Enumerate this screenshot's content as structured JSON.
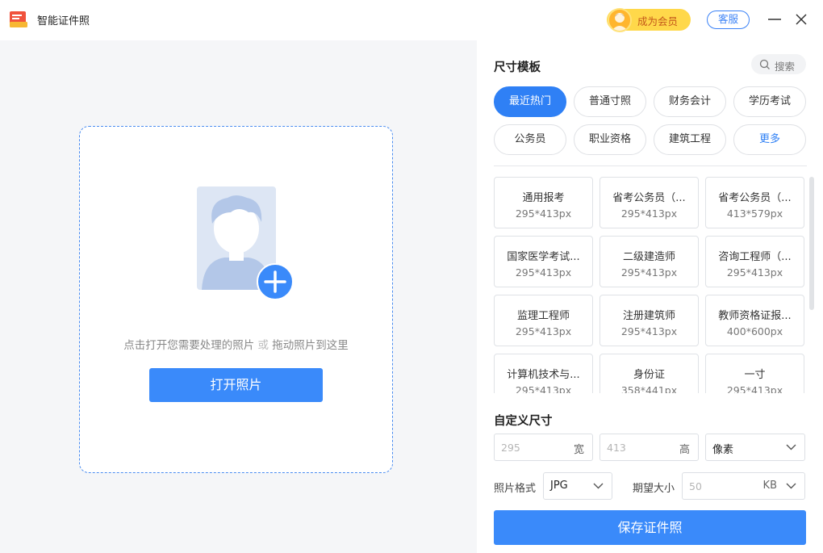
{
  "app": {
    "title": "智能证件照"
  },
  "header": {
    "vip_label": "成为会员",
    "service_label": "客服"
  },
  "upload": {
    "hint_part1": "点击打开您需要处理的照片",
    "hint_or": "或",
    "hint_part2": "拖动照片到这里",
    "open_button": "打开照片"
  },
  "templates": {
    "title": "尺寸模板",
    "search_label": "搜索",
    "categories": [
      "最近热门",
      "普通寸照",
      "财务会计",
      "学历考试",
      "公务员",
      "职业资格",
      "建筑工程",
      "更多"
    ],
    "items": [
      {
        "name": "通用报考",
        "size": "295*413px"
      },
      {
        "name": "省考公务员（...",
        "size": "295*413px"
      },
      {
        "name": "省考公务员（...",
        "size": "413*579px"
      },
      {
        "name": "国家医学考试...",
        "size": "295*413px"
      },
      {
        "name": "二级建造师",
        "size": "295*413px"
      },
      {
        "name": "咨询工程师（...",
        "size": "295*413px"
      },
      {
        "name": "监理工程师",
        "size": "295*413px"
      },
      {
        "name": "注册建筑师",
        "size": "295*413px"
      },
      {
        "name": "教师资格证报...",
        "size": "400*600px"
      },
      {
        "name": "计算机技术与...",
        "size": "295*413px"
      },
      {
        "name": "身份证",
        "size": "358*441px"
      },
      {
        "name": "一寸",
        "size": "295*413px"
      }
    ]
  },
  "custom": {
    "title": "自定义尺寸",
    "width_placeholder": "295",
    "width_unit": "宽",
    "height_placeholder": "413",
    "height_unit": "高",
    "unit_select": "像素",
    "format_label": "照片格式",
    "format_value": "JPG",
    "size_label": "期望大小",
    "size_placeholder": "50",
    "size_unit": "KB",
    "save_button": "保存证件照"
  },
  "colors": {
    "accent": "#3a8afa",
    "vip_bg": "#ffd84a",
    "vip_text": "#c4571a"
  }
}
